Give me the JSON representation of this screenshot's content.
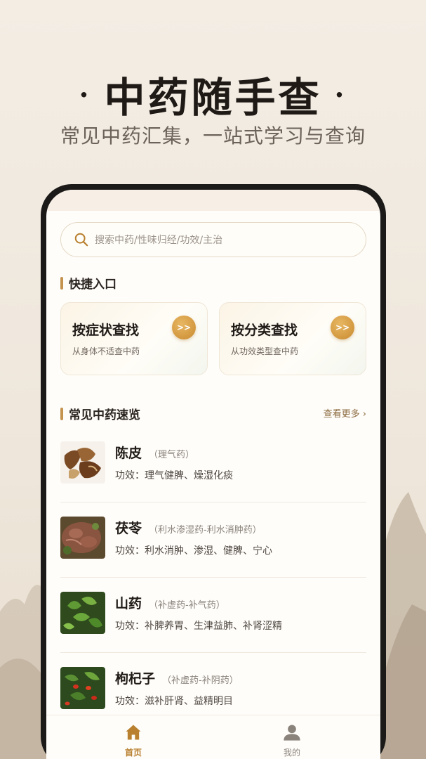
{
  "hero": {
    "dot_left": "·",
    "title": "中药随手查",
    "dot_right": "·",
    "subtitle": "常见中药汇集，一站式学习与查询"
  },
  "search": {
    "placeholder": "搜索中药/性味归经/功效/主治"
  },
  "quick_entry": {
    "title": "快捷入口",
    "cards": [
      {
        "title": "按症状查找",
        "desc": "从身体不适查中药",
        "go": ">>"
      },
      {
        "title": "按分类查找",
        "desc": "从功效类型查中药",
        "go": ">>"
      }
    ]
  },
  "common": {
    "title": "常见中药速览",
    "more": "查看更多 ›",
    "items": [
      {
        "name": "陈皮",
        "category": "（理气药）",
        "effect": "功效：理气健脾、燥湿化痰",
        "image": "chenpi-photo"
      },
      {
        "name": "茯苓",
        "category": "（利水渗湿药-利水消肿药）",
        "effect": "功效：利水消肿、渗湿、健脾、宁心",
        "image": "fuling-photo"
      },
      {
        "name": "山药",
        "category": "（补虚药-补气药）",
        "effect": "功效：补脾养胃、生津益肺、补肾涩精",
        "image": "shanyao-photo"
      },
      {
        "name": "枸杞子",
        "category": "（补虚药-补阴药）",
        "effect": "功效：滋补肝肾、益精明目",
        "image": "gouqi-photo"
      }
    ]
  },
  "tabbar": {
    "tabs": [
      {
        "label": "首页",
        "icon": "home-icon",
        "active": true,
        "color": "#b8802f"
      },
      {
        "label": "我的",
        "icon": "user-icon",
        "active": false,
        "color": "#8a837b"
      }
    ]
  },
  "colors": {
    "accent": "#c4934e",
    "accent_dark": "#b8802f",
    "background": "#f3ede4"
  }
}
